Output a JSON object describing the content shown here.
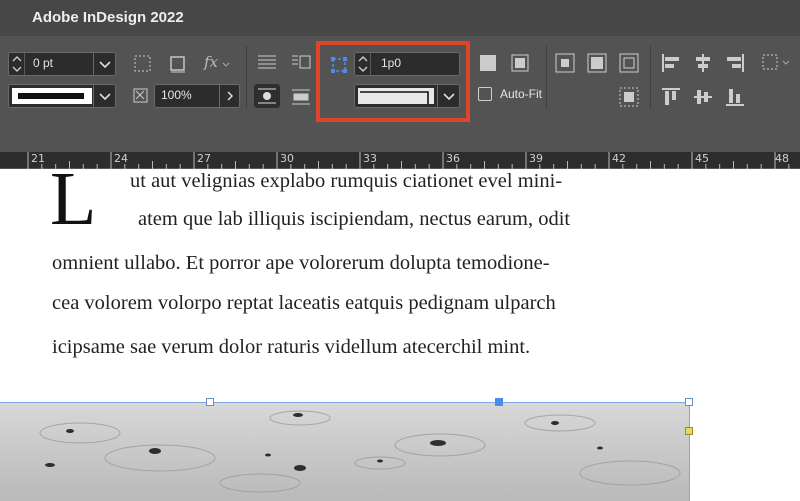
{
  "window": {
    "title": "Adobe InDesign 2022"
  },
  "controls": {
    "stroke_weight": "0 pt",
    "opacity": "100%",
    "corner_size": "1p0",
    "auto_fit_label": "Auto-Fit",
    "auto_fit_checked": false
  },
  "ruler": {
    "labels": [
      "21",
      "24",
      "27",
      "30",
      "33",
      "36",
      "39",
      "42",
      "45",
      "48"
    ]
  },
  "document": {
    "drop_cap": "L",
    "lines": [
      "ut aut velignias explabo rumquis ciationet evel mini-",
      "atem que lab illiquis iscipiendam, nectus earum, odit",
      "omnient ullabo. Et porror ape volorerum dolupta temodione-",
      "cea volorem volorpo reptat laceatis eatquis pedignam ulparch",
      "icipsame sae verum dolor raturis videllum atecerchil mint."
    ]
  },
  "colors": {
    "highlight": "#e0452c",
    "selection": "#4a8ee8",
    "panel": "#535353"
  },
  "icons": [
    "stroke-style-icon",
    "frame-fitting-icon",
    "fx-icon",
    "text-wrap-icon",
    "corner-options-icon",
    "align-icon",
    "distribute-icon"
  ]
}
